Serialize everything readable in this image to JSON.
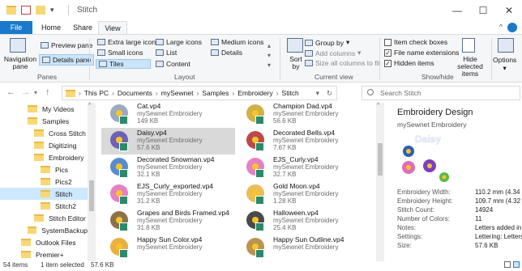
{
  "window": {
    "title": "Stitch",
    "minimize": "—",
    "maximize": "☐",
    "close": "✕"
  },
  "ribbon_tabs": [
    "File",
    "Home",
    "Share",
    "View"
  ],
  "ribbon": {
    "panes": {
      "navigation_pane": "Navigation pane",
      "preview_pane": "Preview pane",
      "details_pane": "Details pane",
      "label": "Panes"
    },
    "layout": {
      "extra_large_icons": "Extra large icons",
      "large_icons": "Large icons",
      "medium_icons": "Medium icons",
      "small_icons": "Small icons",
      "list": "List",
      "details": "Details",
      "tiles": "Tiles",
      "content": "Content",
      "label": "Layout"
    },
    "current_view": {
      "sort_by": "Sort by",
      "group_by": "Group by",
      "add_columns": "Add columns",
      "size_all_columns": "Size all columns to fit",
      "label": "Current view"
    },
    "show_hide": {
      "item_check_boxes": "Item check boxes",
      "file_name_extensions": "File name extensions",
      "hidden_items": "Hidden items",
      "hide_selected_items": "Hide selected items",
      "label": "Show/hide"
    },
    "options": "Options"
  },
  "breadcrumb": [
    "This PC",
    "Documents",
    "mySewnet",
    "Samples",
    "Embroidery",
    "Stitch"
  ],
  "search": {
    "placeholder": "Search Stitch"
  },
  "nav_items": [
    {
      "label": "My Videos",
      "indent": 1
    },
    {
      "label": "Samples",
      "indent": 1
    },
    {
      "label": "Cross Stitch",
      "indent": 2
    },
    {
      "label": "Digitizing",
      "indent": 2
    },
    {
      "label": "Embroidery",
      "indent": 2
    },
    {
      "label": "Pics",
      "indent": 3
    },
    {
      "label": "Pics2",
      "indent": 3
    },
    {
      "label": "Stitch",
      "indent": 3,
      "selected": true
    },
    {
      "label": "Stitch2",
      "indent": 3
    },
    {
      "label": "Stitch Editor",
      "indent": 2
    },
    {
      "label": "SystemBackup",
      "indent": 1
    },
    {
      "label": "Outlook Files",
      "indent": 0
    },
    {
      "label": "Premier+",
      "indent": 0
    }
  ],
  "files": [
    {
      "name": "Cat.vp4",
      "type": "mySewnet Embroidery",
      "size": "149 KB",
      "thumb_color": "#8a9bb5"
    },
    {
      "name": "Champion Dad.vp4",
      "type": "mySewnet Embroidery",
      "size": "56.6 KB",
      "thumb_color": "#c9a227"
    },
    {
      "name": "Daisy.vp4",
      "type": "mySewnet Embroidery",
      "size": "57.6 KB",
      "thumb_color": "#5a4bb0",
      "selected": true
    },
    {
      "name": "Decorated Bells.vp4",
      "type": "mySewnet Embroidery",
      "size": "7.67 KB",
      "thumb_color": "#b02a2a"
    },
    {
      "name": "Decorated Snowman.vp4",
      "type": "mySewnet Embroidery",
      "size": "32.1 KB",
      "thumb_color": "#3a78c9"
    },
    {
      "name": "EJS_Curly.vp4",
      "type": "mySewnet Embroidery",
      "size": "32.7 KB",
      "thumb_color": "#e06bb8"
    },
    {
      "name": "EJS_Curly_exported.vp4",
      "type": "mySewnet Embroidery",
      "size": "31.2 KB",
      "thumb_color": "#e06bb8"
    },
    {
      "name": "Gold Moon.vp4",
      "type": "mySewnet Embroidery",
      "size": "1.28 KB",
      "thumb_color": "#e8b23a"
    },
    {
      "name": "Grapes and Birds Framed.vp4",
      "type": "mySewnet Embroidery",
      "size": "31.8 KB",
      "thumb_color": "#7a5a2a"
    },
    {
      "name": "Halloween.vp4",
      "type": "mySewnet Embroidery",
      "size": "25.4 KB",
      "thumb_color": "#2a2a2a"
    },
    {
      "name": "Happy Sun Color.vp4",
      "type": "mySewnet Embroidery",
      "size": "",
      "thumb_color": "#e8a020"
    },
    {
      "name": "Happy Sun Outline.vp4",
      "type": "mySewnet Embroidery",
      "size": "",
      "thumb_color": "#b08030"
    }
  ],
  "details": {
    "title": "Embroidery Design",
    "subtitle": "mySewnet Embroidery",
    "preview_text": "Daisy",
    "rows": [
      {
        "label": "Embroidery Width:",
        "value": "110.2 mm (4.34 \")"
      },
      {
        "label": "Embroidery Height:",
        "value": "109.7 mm (4.32 \")"
      },
      {
        "label": "Stitch Count:",
        "value": "14924"
      },
      {
        "label": "Number of Colors:",
        "value": "11"
      },
      {
        "label": "Notes:",
        "value": "Letters added in PR..."
      },
      {
        "label": "Settings:",
        "value": "Lettering: Letters: ..."
      },
      {
        "label": "Size:",
        "value": "57.6 KB"
      }
    ]
  },
  "status": {
    "items": "54 items",
    "selected": "1 item selected",
    "size": "57.6 KB"
  },
  "colors": {
    "accent": "#1979ca",
    "selected_nav": "#cde8ff",
    "selected_file": "#d9d9d9"
  }
}
